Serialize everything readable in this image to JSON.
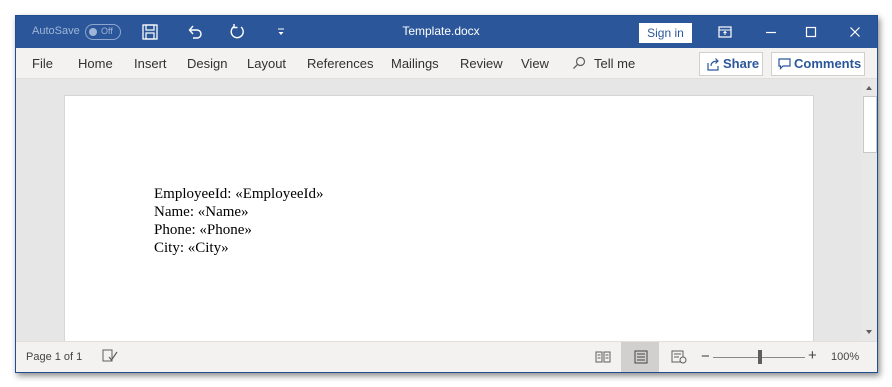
{
  "titlebar": {
    "autosave_label": "AutoSave",
    "autosave_state": "Off",
    "doc_title": "Template.docx",
    "sign_in_label": "Sign in",
    "icons": [
      "save-icon",
      "undo-icon",
      "redo-icon",
      "customize-quick-access-icon",
      "ribbon-display-options-icon",
      "minimize-icon",
      "maximize-icon",
      "close-icon"
    ]
  },
  "menu": {
    "items": [
      "File",
      "Home",
      "Insert",
      "Design",
      "Layout",
      "References",
      "Mailings",
      "Review",
      "View"
    ],
    "tell_me": "Tell me",
    "share_label": "Share",
    "comments_label": "Comments"
  },
  "document": {
    "lines": [
      "EmployeeId: «EmployeeId»",
      "Name: «Name»",
      "Phone: «Phone»",
      "City: «City»"
    ]
  },
  "status": {
    "page_count": "Page 1 of 1",
    "zoom_minus": "−",
    "zoom_plus": "+",
    "zoom_level": "100%",
    "zoom_fraction": 0.5
  },
  "colors": {
    "title_bar": "#2b579a",
    "accent_text": "#2b579a"
  }
}
